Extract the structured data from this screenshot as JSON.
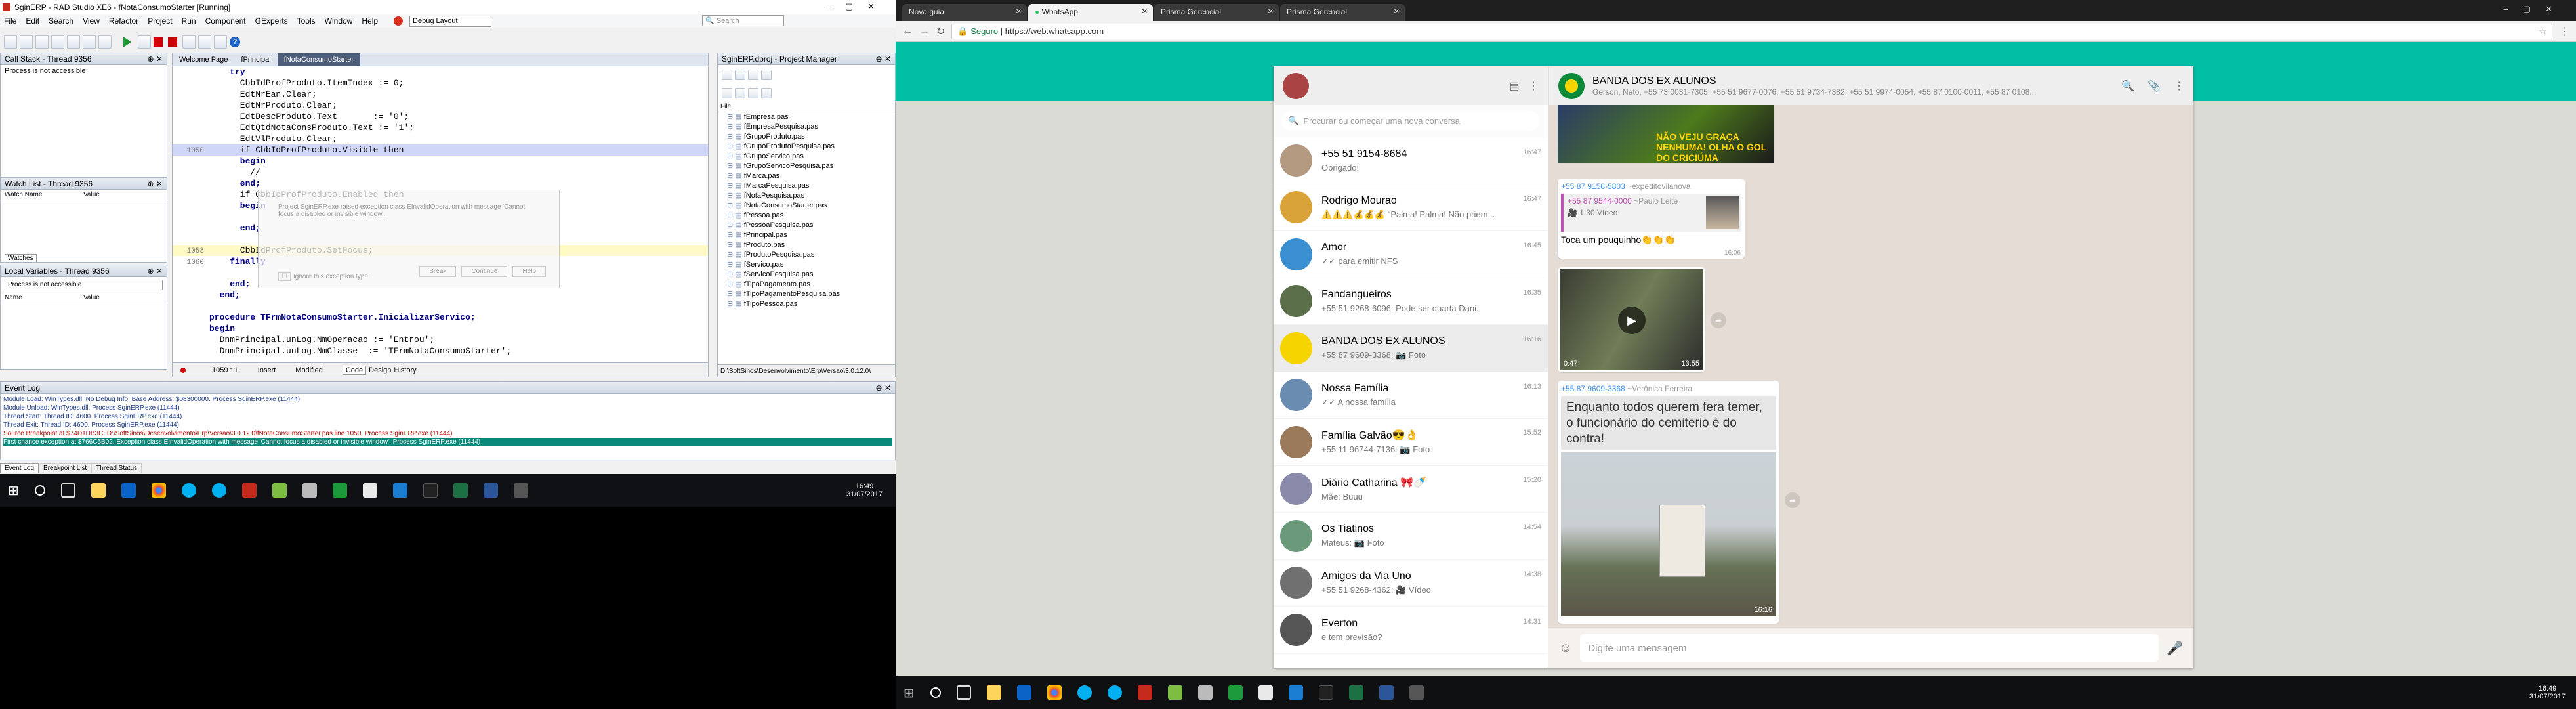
{
  "ide": {
    "title": "SginERP - RAD Studio XE6 - fNotaConsumoStarter [Running]",
    "menu": [
      "File",
      "Edit",
      "Search",
      "View",
      "Refactor",
      "Project",
      "Run",
      "Component",
      "GExperts",
      "Tools",
      "Window",
      "Help"
    ],
    "layout_combo": "Debug Layout",
    "search_placeholder": "Search",
    "call_stack": {
      "title": "Call Stack - Thread 9356",
      "text": "Process is not accessible"
    },
    "watch_list": {
      "title": "Watch List - Thread 9356",
      "col_name": "Watch Name",
      "col_value": "Value",
      "tab": "Watches"
    },
    "local_vars": {
      "title": "Local Variables - Thread 9356",
      "combo": "Process is not accessible",
      "col_name": "Name",
      "col_value": "Value"
    },
    "editor_tabs": [
      "Welcome Page",
      "fPrincipal",
      "fNotaConsumoStarter"
    ],
    "code_lines": [
      {
        "n": "",
        "t": "    try"
      },
      {
        "n": "",
        "t": "      CbbIdProfProduto.ItemIndex := 0;"
      },
      {
        "n": "",
        "t": "      EdtNrEan.Clear;"
      },
      {
        "n": "",
        "t": "      EdtNrProduto.Clear;"
      },
      {
        "n": "",
        "t": "      EdtDescProduto.Text       := '0';"
      },
      {
        "n": "",
        "t": "      EdtQtdNotaConsProduto.Text := '1';"
      },
      {
        "n": "",
        "t": "      EdtVlProduto.Clear;"
      },
      {
        "n": "1050",
        "t": "      if CbbIdProfProduto.Visible then"
      },
      {
        "n": "",
        "t": "      begin"
      },
      {
        "n": "",
        "t": "        //"
      },
      {
        "n": "",
        "t": "      end;"
      },
      {
        "n": "",
        "t": "      if CbbIdProfProduto.Enabled then"
      },
      {
        "n": "",
        "t": "      begin"
      },
      {
        "n": "",
        "t": ""
      },
      {
        "n": "",
        "t": "      end;"
      },
      {
        "n": "",
        "t": ""
      },
      {
        "n": "1058",
        "t": "      CbbIdProfProduto.SetFocus;"
      },
      {
        "n": "1060",
        "t": "    finally"
      },
      {
        "n": "",
        "t": ""
      },
      {
        "n": "",
        "t": "    end;"
      },
      {
        "n": "",
        "t": "  end;"
      },
      {
        "n": "",
        "t": ""
      },
      {
        "n": "",
        "t": "procedure TFrmNotaConsumoStarter.InicializarServico;"
      },
      {
        "n": "",
        "t": "begin"
      },
      {
        "n": "",
        "t": "  DnmPrincipal.unLog.NmOperacao := 'Entrou';"
      },
      {
        "n": "",
        "t": "  DnmPrincipal.unLog.NmClasse  := 'TFrmNotaConsumoStarter';"
      }
    ],
    "exception_dialog": {
      "text": "Project SginERP.exe raised exception class EInvalidOperation with message 'Cannot focus a disabled or invisible window'.",
      "buttons": [
        "Break",
        "Continue",
        "Help"
      ],
      "checkbox": "Ignore this exception type"
    },
    "status_bar": {
      "pos": "1059 : 1",
      "mode": "Insert",
      "state": "Modified",
      "tabs": [
        "Code",
        "Design",
        "History"
      ]
    },
    "project_manager": {
      "title": "SginERP.dproj - Project Manager",
      "file_label": "File",
      "files": [
        "fEmpresa.pas",
        "fEmpresaPesquisa.pas",
        "fGrupoProduto.pas",
        "fGrupoProdutoPesquisa.pas",
        "fGrupoServico.pas",
        "fGrupoServicoPesquisa.pas",
        "fMarca.pas",
        "fMarcaPesquisa.pas",
        "fNotaPesquisa.pas",
        "fNotaConsumoStarter.pas",
        "fPessoa.pas",
        "fPessoaPesquisa.pas",
        "fPrincipal.pas",
        "fProduto.pas",
        "fProdutoPesquisa.pas",
        "fServico.pas",
        "fServicoPesquisa.pas",
        "fTipoPagamento.pas",
        "fTipoPagamentoPesquisa.pas",
        "fTipoPessoa.pas"
      ],
      "path": "D:\\SoftSinos\\Desenvolvimento\\Erp\\Versao\\3.0.12.0\\"
    },
    "event_log": {
      "title": "Event Log",
      "lines": [
        "Module Load: WinTypes.dll. No Debug Info. Base Address: $08300000. Process SginERP.exe (11444)",
        "Module Unload: WinTypes.dll. Process SginERP.exe (11444)",
        "Thread Start: Thread ID: 4600. Process SginERP.exe (11444)",
        "Thread Exit: Thread ID: 4600. Process SginERP.exe (11444)",
        "Source Breakpoint at $74D1DB3C: D:\\SoftSinos\\Desenvolvimento\\Erp\\Versao\\3.0.12.0\\fNotaConsumoStarter.pas line 1050. Process SginERP.exe (11444)",
        "First chance exception at $766C5B02. Exception class EInvalidOperation with message 'Cannot focus a disabled or invisible window'. Process SginERP.exe (11444)"
      ],
      "tabs": [
        "Event Log",
        "Breakpoint List",
        "Thread Status"
      ]
    }
  },
  "taskbar_left": {
    "time": "16:49",
    "date": "31/07/2017"
  },
  "taskbar_right": {
    "time": "16:49",
    "date": "31/07/2017"
  },
  "browser": {
    "tabs": [
      "Nova guia",
      "WhatsApp",
      "Prisma Gerencial",
      "Prisma Gerencial"
    ],
    "secure_label": "Seguro",
    "url": "https://web.whatsapp.com"
  },
  "whatsapp": {
    "search_placeholder": "Procurar ou começar uma nova conversa",
    "chats": [
      {
        "name": "+55 51 9154-8684",
        "msg": "Obrigado!",
        "time": "16:47"
      },
      {
        "name": "Rodrigo Mourao",
        "msg": "⚠️⚠️⚠️💰💰💰 \"Palma! Palma! Não priem...",
        "time": "16:47"
      },
      {
        "name": "Amor",
        "msg": "✓✓ para emitir NFS",
        "time": "16:45"
      },
      {
        "name": "Fandangueiros",
        "msg": "+55 51 9268-6096: Pode ser quarta Dani.",
        "time": "16:35"
      },
      {
        "name": "BANDA DOS EX ALUNOS",
        "msg": "+55 87 9609-3368: 📷 Foto",
        "time": "16:16"
      },
      {
        "name": "Nossa Família",
        "msg": "✓✓ A nossa família",
        "time": "16:13"
      },
      {
        "name": "Família Galvão😎👌",
        "msg": "+55 11 96744-7136: 📷 Foto",
        "time": "15:52"
      },
      {
        "name": "Diário Catharina 🎀🍼",
        "msg": "Mãe: Buuu",
        "time": "15:20"
      },
      {
        "name": "Os Tiatinos",
        "msg": "Mateus: 📷 Foto",
        "time": "14:54"
      },
      {
        "name": "Amigos da Via Uno",
        "msg": "+55 51 9268-4362: 🎥 Vídeo",
        "time": "14:38"
      },
      {
        "name": "Everton",
        "msg": "e tem previsão?",
        "time": "14:31"
      }
    ],
    "group_name": "BANDA DOS EX ALUNOS",
    "group_members": "Gerson, Neto, +55 73 0031-7305, +55 51 9677-0076, +55 51 9734-7382, +55 51 9974-0054, +55 87 0100-0011, +55 87 0108...",
    "messages": {
      "img_caption": "NÃO VEJU GRAÇA NENHUMA! OLHA O GOL DO CRICIÚMA",
      "reply_sender": "+55 87 9158-5803",
      "reply_alias": "~expeditovilanova",
      "quoted_sender": "+55 87 9544-0000",
      "quoted_alias": "~Paulo Leite",
      "quoted_text": "🎥 1:30 Vídeo",
      "reply_text": "Toca um pouquinho👏👏👏",
      "reply_time": "16:06",
      "video_duration": "0:47",
      "video_time": "13:55",
      "photo_sender": "+55 87 9609-3368",
      "photo_alias": "~Verônica Ferreira",
      "photo_text": "Enquanto todos querem fera temer, o funcionário do cemitério é do contra!",
      "photo_time": "16:16"
    },
    "input_placeholder": "Digite uma mensagem"
  }
}
